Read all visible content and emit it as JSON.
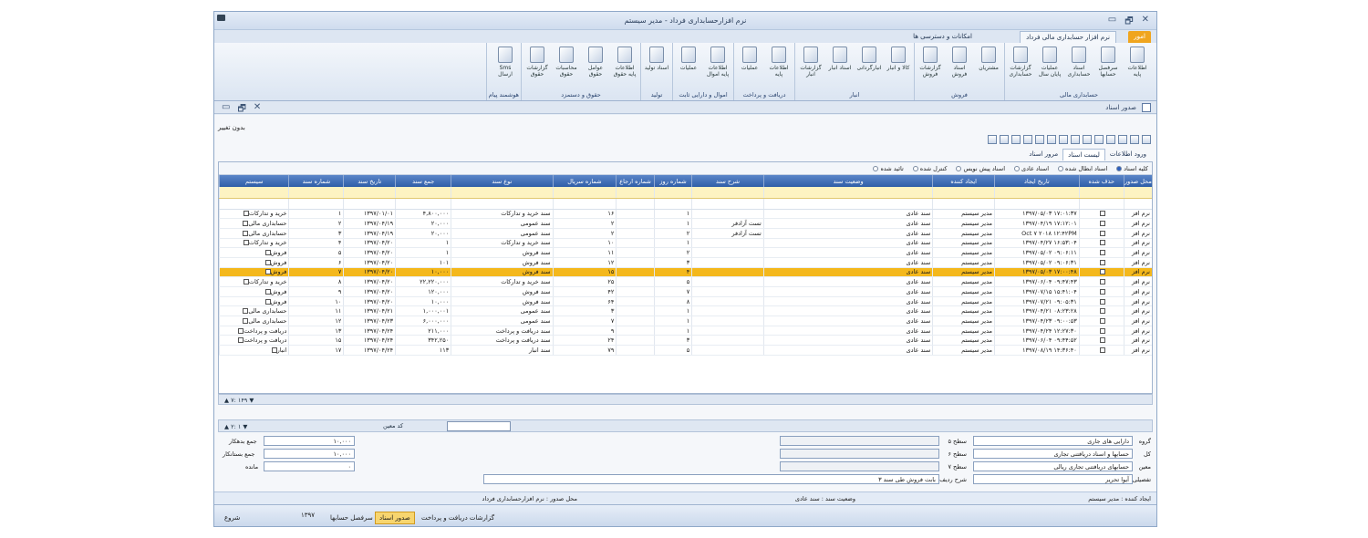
{
  "window": {
    "title": "نرم افزارحسابداری فرداد - مدیر سیستم",
    "controls": [
      "▭",
      "🗗",
      "✕"
    ]
  },
  "menu_tabs": {
    "first": "امور",
    "active": "نرم افزار حسابداری مالی فرداد",
    "other": "امکانات و دسترسی ها"
  },
  "ribbon": [
    {
      "name": "حسابداری مالی",
      "items": [
        "اطلاعات پایه",
        "سرفصل حسابها",
        "اسناد حسابداری",
        "عملیات پایان سال",
        "گزارشات حسابداری"
      ]
    },
    {
      "name": "فروش",
      "items": [
        "مشتریان",
        "اسناد فروش",
        "گزارشات فروش"
      ]
    },
    {
      "name": "انبار",
      "items": [
        "کالا و انبار",
        "انبارگردانی",
        "اسناد انبار",
        "گزارشات انبار"
      ]
    },
    {
      "name": "دریافت و پرداخت",
      "items": [
        "اطلاعات پایه",
        "عملیات"
      ]
    },
    {
      "name": "اموال و دارایی ثابت",
      "items": [
        "اطلاعات پایه اموال",
        "عملیات"
      ]
    },
    {
      "name": "تولید",
      "items": [
        "اسناد تولید"
      ]
    },
    {
      "name": "حقوق و دستمزد",
      "items": [
        "اطلاعات پایه حقوق",
        "عوامل حقوق",
        "محاسبات حقوق",
        "گزارشات حقوق"
      ]
    },
    {
      "name": "هوشمند پیام",
      "items": [
        "Sms ارسال"
      ]
    }
  ],
  "doc_window": {
    "title": "صدور اسناد",
    "controls": [
      "▭",
      "🗗",
      "✕"
    ],
    "no_change": "بدون تغییر"
  },
  "sub_tabs": {
    "entry": "ورود اطلاعات",
    "list": "لیست اسناد",
    "review": "مرور اسناد"
  },
  "filters": [
    "کلیه اسناد",
    "اسناد ابطال شده",
    "اسناد عادی",
    "اسناد پیش نویس",
    "کنترل شده",
    "تائید شده"
  ],
  "columns": [
    "سیستم",
    "شماره سند",
    "تاریخ سند",
    "جمع سند",
    "نوع سند",
    "شماره سریال",
    "شماره ارجاع",
    "شماره روز",
    "شرح سند",
    "وضعیت سند",
    "ایجاد کننده",
    "تاریخ ایجاد",
    "حذف شده",
    "محل صدور"
  ],
  "rows": [
    [
      "خرید و تدارکات",
      "۱",
      "۱۳۹۷/۰۱/۰۱",
      "۴,۸۰۰,۰۰۰",
      "سند خرید و تدارکات",
      "۱۶",
      "",
      "۱",
      "",
      "سند عادی",
      "مدیر سیستم",
      "۱۳۹۷/۰۵/۰۳ ۱۷:۰۱:۳۷",
      "",
      "نرم افز"
    ],
    [
      "حسابداری مالی",
      "۲",
      "۱۳۹۷/۰۴/۱۹",
      "۲۰,۰۰۰",
      "سند عمومی",
      "۲",
      "",
      "۱",
      "تست آزادفر",
      "سند عادی",
      "مدیر سیستم",
      "۱۳۹۷/۰۴/۱۹ ۱۷:۱۲:۰۱",
      "",
      "نرم افز"
    ],
    [
      "حسابداری مالی",
      "۳",
      "۱۳۹۷/۰۴/۱۹",
      "۲۰,۰۰۰",
      "سند عمومی",
      "۲",
      "",
      "۲",
      "تست آزادفر",
      "سند عادی",
      "مدیر سیستم",
      "Oct ۷ ۲۰۱۸ ۱۲:۴۲PM",
      "",
      "نرم افز"
    ],
    [
      "خرید و تدارکات",
      "۴",
      "۱۳۹۷/۰۴/۲۰",
      "۱",
      "سند خرید و تدارکات",
      "۱۰",
      "",
      "۱",
      "",
      "سند عادی",
      "مدیر سیستم",
      "۱۳۹۷/۰۴/۲۷ ۱۶:۵۳:۰۴",
      "",
      "نرم افز"
    ],
    [
      "فروش",
      "۵",
      "۱۳۹۷/۰۴/۲۰",
      "۱",
      "سند فروش",
      "۱۱",
      "",
      "۲",
      "",
      "سند عادی",
      "مدیر سیستم",
      "۱۳۹۷/۰۵/۰۲ ۰۹:۰۶:۱۱",
      "",
      "نرم افز"
    ],
    [
      "فروش",
      "۶",
      "۱۳۹۷/۰۴/۲۰",
      "۱۰۱",
      "سند فروش",
      "۱۲",
      "",
      "۳",
      "",
      "سند عادی",
      "مدیر سیستم",
      "۱۳۹۷/۰۵/۰۲ ۰۹:۰۶:۳۱",
      "",
      "نرم افز"
    ],
    [
      "فروش",
      "۷",
      "۱۳۹۷/۰۴/۲۰",
      "۱۰,۰۰۰",
      "سند فروش",
      "۱۵",
      "",
      "۴",
      "",
      "سند عادی",
      "مدیر سیستم",
      "۱۳۹۷/۰۵/۰۳ ۱۷:۰۰:۴۸",
      "",
      "نرم افز"
    ],
    [
      "خرید و تدارکات",
      "۸",
      "۱۳۹۷/۰۴/۲۰",
      "۲۲,۲۲۰,۰۰۰",
      "سند خرید و تدارکات",
      "۲۵",
      "",
      "۵",
      "",
      "سند عادی",
      "مدیر سیستم",
      "۱۳۹۷/۰۶/۰۴ ۰۹:۴۷:۴۳",
      "",
      "نرم افز"
    ],
    [
      "فروش",
      "۹",
      "۱۳۹۷/۰۴/۲۰",
      "۱۲۰,۰۰۰",
      "سند فروش",
      "۴۲",
      "",
      "۷",
      "",
      "سند عادی",
      "مدیر سیستم",
      "۱۳۹۷/۰۷/۱۵ ۱۵:۴۱:۰۴",
      "",
      "نرم افز"
    ],
    [
      "فروش",
      "۱۰",
      "۱۳۹۷/۰۴/۲۰",
      "۱۰,۰۰۰",
      "سند فروش",
      "۶۴",
      "",
      "۸",
      "",
      "سند عادی",
      "مدیر سیستم",
      "۱۳۹۷/۰۷/۲۱ ۰۹:۰۵:۳۱",
      "",
      "نرم افز"
    ],
    [
      "حسابداری مالی",
      "۱۱",
      "۱۳۹۷/۰۴/۲۱",
      "۱,۰۰۰,۰۰۱",
      "سند عمومی",
      "۳",
      "",
      "۱",
      "",
      "سند عادی",
      "مدیر سیستم",
      "۱۳۹۷/۰۴/۲۱ ۰۸:۲۳:۲۸",
      "",
      "نرم افز"
    ],
    [
      "حسابداری مالی",
      "۱۲",
      "۱۳۹۷/۰۴/۲۳",
      "۶,۰۰۰,۰۰۰",
      "سند عمومی",
      "۷",
      "",
      "۱",
      "",
      "سند عادی",
      "مدیر سیستم",
      "۱۳۹۷/۰۴/۲۳ ۰۹:۰۰:۵۳",
      "",
      "نرم افز"
    ],
    [
      "دریافت و پرداخت",
      "۱۳",
      "۱۳۹۷/۰۴/۲۴",
      "۲۱۱,۰۰۰",
      "سند دریافت و پرداخت",
      "۹",
      "",
      "۱",
      "",
      "سند عادی",
      "مدیر سیستم",
      "۱۳۹۷/۰۴/۲۴ ۱۲:۲۷:۳۰",
      "",
      "نرم افز"
    ],
    [
      "دریافت و پرداخت",
      "۱۵",
      "۱۳۹۷/۰۴/۲۴",
      "۳۴۲,۲۵۰",
      "سند دریافت و پرداخت",
      "۲۴",
      "",
      "۳",
      "",
      "سند عادی",
      "مدیر سیستم",
      "۱۳۹۷/۰۶/۰۴ ۰۹:۴۴:۵۲",
      "",
      "نرم افز"
    ],
    [
      "انبار",
      "۱۷",
      "۱۳۹۷/۰۴/۲۴",
      "۱۱۳",
      "سند انبار",
      "۷۹",
      "",
      "۵",
      "",
      "سند عادی",
      "مدیر سیستم",
      "۱۳۹۷/۰۸/۱۹ ۱۴:۳۶:۴۰",
      "",
      "نرم افز"
    ]
  ],
  "selected_row": 6,
  "nav_bar": {
    "count": "۷: ۱۴۹"
  },
  "detail_bar": {
    "count": "۲: ۱",
    "code_label": "کد معین"
  },
  "detail": {
    "group_label": "گروه",
    "group": "دارایی های جاری",
    "kol_label": "کل",
    "kol": "حسابها و اسناد دریافتنی تجاری",
    "moin_label": "معین",
    "moin": "حسابهای دریافتنی تجاری ریالی",
    "tafsili_label": "تفصیلی",
    "tafsili": "آیوا تحریر",
    "s5": "سطح ۵",
    "s6": "سطح ۶",
    "s7": "سطح ۷",
    "sharh_label": "شرح ردیف",
    "sharh": "بابت فروش طی سند ۳",
    "debit_label": "جمع بدهکار",
    "debit": "۱۰,۰۰۰",
    "credit_label": "جمع بستانکار",
    "credit": "۱۰,۰۰۰",
    "rem_label": "مانده",
    "rem": "۰"
  },
  "status": {
    "creator": "ایجاد کننده : مدیر سیستم",
    "state": "وضعیت سند : سند عادی",
    "place": "محل صدور : نرم افزارحسابداری فرداد"
  },
  "taskbar": {
    "start": "شروع",
    "year": "۱۳۹۷",
    "t1": "سرفصل حسابها",
    "t2": "صدور اسناد",
    "t3": "گزارشات دریافت و پرداخت"
  }
}
